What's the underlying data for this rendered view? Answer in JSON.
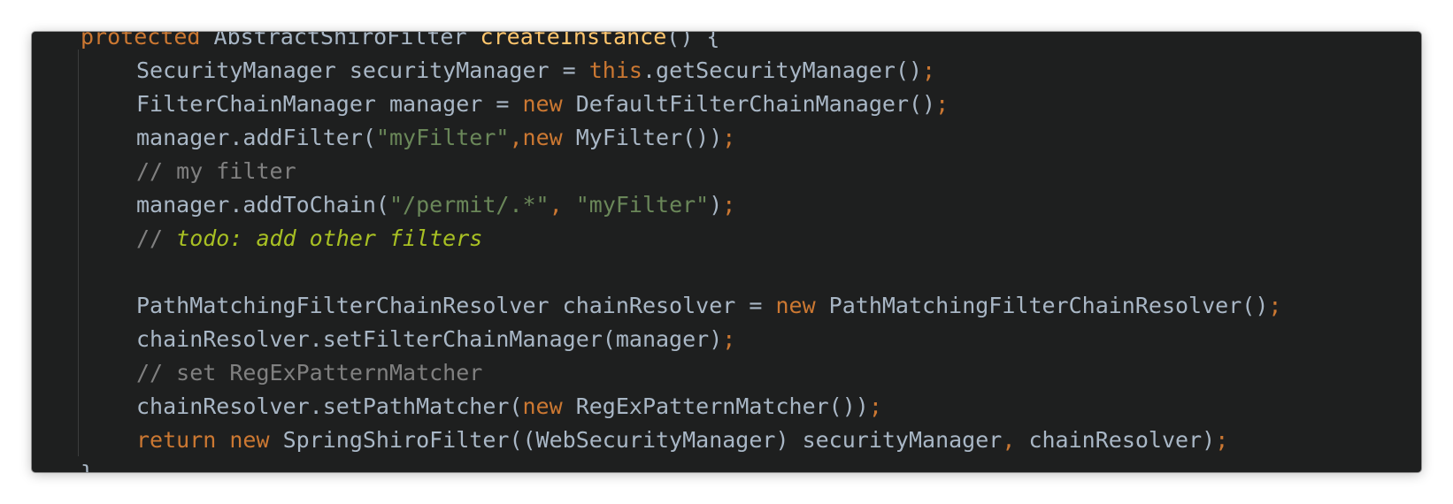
{
  "editor": {
    "lines": [
      {
        "type": "outer",
        "tokens": [
          {
            "c": "kw",
            "t": "protected"
          },
          {
            "c": "plain",
            "t": " AbstractShiroFilter "
          },
          {
            "c": "fn",
            "t": "createInstance"
          },
          {
            "c": "plain",
            "t": "() {"
          }
        ]
      },
      {
        "type": "inner",
        "tokens": [
          {
            "c": "plain",
            "t": "SecurityManager securityManager = "
          },
          {
            "c": "kw",
            "t": "this"
          },
          {
            "c": "plain",
            "t": ".getSecurityManager()"
          },
          {
            "c": "punct",
            "t": ";"
          }
        ]
      },
      {
        "type": "inner",
        "tokens": [
          {
            "c": "plain",
            "t": "FilterChainManager manager = "
          },
          {
            "c": "kw",
            "t": "new"
          },
          {
            "c": "plain",
            "t": " DefaultFilterChainManager()"
          },
          {
            "c": "punct",
            "t": ";"
          }
        ]
      },
      {
        "type": "inner",
        "tokens": [
          {
            "c": "plain",
            "t": "manager.addFilter("
          },
          {
            "c": "str",
            "t": "\"myFilter\""
          },
          {
            "c": "punct",
            "t": ","
          },
          {
            "c": "kw",
            "t": "new"
          },
          {
            "c": "plain",
            "t": " MyFilter())"
          },
          {
            "c": "punct",
            "t": ";"
          }
        ]
      },
      {
        "type": "inner",
        "tokens": [
          {
            "c": "cm",
            "t": "// my filter"
          }
        ]
      },
      {
        "type": "inner",
        "tokens": [
          {
            "c": "plain",
            "t": "manager.addToChain("
          },
          {
            "c": "str",
            "t": "\"/permit/.*\""
          },
          {
            "c": "punct",
            "t": ", "
          },
          {
            "c": "str",
            "t": "\"myFilter\""
          },
          {
            "c": "plain",
            "t": ")"
          },
          {
            "c": "punct",
            "t": ";"
          }
        ]
      },
      {
        "type": "inner",
        "tokens": [
          {
            "c": "cm",
            "t": "// "
          },
          {
            "c": "todo",
            "t": "todo: add other filters"
          }
        ]
      },
      {
        "type": "inner",
        "tokens": []
      },
      {
        "type": "inner",
        "tokens": [
          {
            "c": "plain",
            "t": "PathMatchingFilterChainResolver chainResolver = "
          },
          {
            "c": "kw",
            "t": "new"
          },
          {
            "c": "plain",
            "t": " PathMatchingFilterChainResolver()"
          },
          {
            "c": "punct",
            "t": ";"
          }
        ]
      },
      {
        "type": "inner",
        "tokens": [
          {
            "c": "plain",
            "t": "chainResolver.setFilterChainManager(manager)"
          },
          {
            "c": "punct",
            "t": ";"
          }
        ]
      },
      {
        "type": "inner",
        "tokens": [
          {
            "c": "cm",
            "t": "// set RegExPatternMatcher"
          }
        ]
      },
      {
        "type": "inner",
        "tokens": [
          {
            "c": "plain",
            "t": "chainResolver.setPathMatcher("
          },
          {
            "c": "kw",
            "t": "new"
          },
          {
            "c": "plain",
            "t": " RegExPatternMatcher())"
          },
          {
            "c": "punct",
            "t": ";"
          }
        ]
      },
      {
        "type": "inner",
        "tokens": [
          {
            "c": "kw",
            "t": "return new"
          },
          {
            "c": "plain",
            "t": " SpringShiroFilter((WebSecurityManager) securityManager"
          },
          {
            "c": "punct",
            "t": ","
          },
          {
            "c": "plain",
            "t": " chainResolver)"
          },
          {
            "c": "punct",
            "t": ";"
          }
        ]
      },
      {
        "type": "outer",
        "tokens": [
          {
            "c": "plain",
            "t": "}"
          }
        ]
      }
    ]
  },
  "colors": {
    "background": "#1e1f1f",
    "keyword": "#cc7832",
    "method": "#ffc66d",
    "string": "#6a8759",
    "comment": "#808080",
    "todo": "#a8c023",
    "text": "#a9b7c6"
  }
}
